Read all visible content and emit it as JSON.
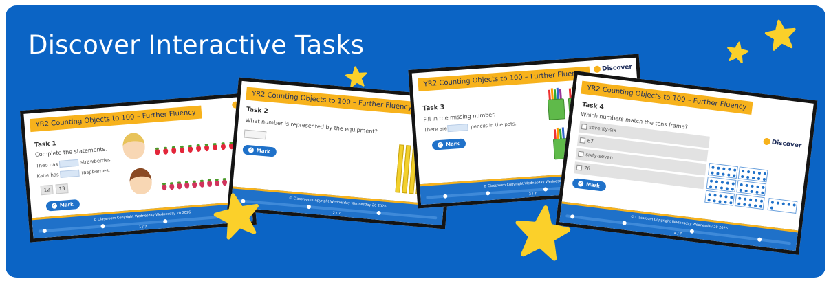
{
  "banner": {
    "title": "Discover Interactive Tasks",
    "background": "#0b64c5",
    "star_color": "#fbd02a"
  },
  "slides": [
    {
      "header": "YR2 Counting Objects to 100 – Further Fluency",
      "task": "Task 1",
      "question": "Complete the statements.",
      "line1_a": "Theo has",
      "line1_b": "strawberries.",
      "line2_a": "Katie has",
      "line2_b": "raspberries.",
      "tiles": [
        "12",
        "13"
      ],
      "mark": "Mark",
      "pager": "1 / 7",
      "logo": "Di"
    },
    {
      "header": "YR2 Counting Objects to 100 – Further Fluency",
      "task": "Task 2",
      "question": "What number is represented by the equipment?",
      "mark": "Mark",
      "pager": "2 / 7"
    },
    {
      "header": "YR2 Counting Objects to 100 – Further Fluency",
      "task": "Task 3",
      "question": "Fill in the missing number.",
      "line_a": "There are",
      "line_b": "pencils in the pots.",
      "mark": "Mark",
      "pager": "3 / 7",
      "logo": "Discover"
    },
    {
      "header": "YR2 Counting Objects to 100 – Further Fluency",
      "task": "Task 4",
      "question": "Which numbers match the tens frame?",
      "options": [
        "seventy-six",
        "67",
        "sixty-seven",
        "76"
      ],
      "mark": "Mark",
      "pager": "4 / 7",
      "logo": "Discover"
    }
  ],
  "footer": {
    "copyright": "© Classroom Copyright Wednesday Wednesday 20 2026"
  }
}
